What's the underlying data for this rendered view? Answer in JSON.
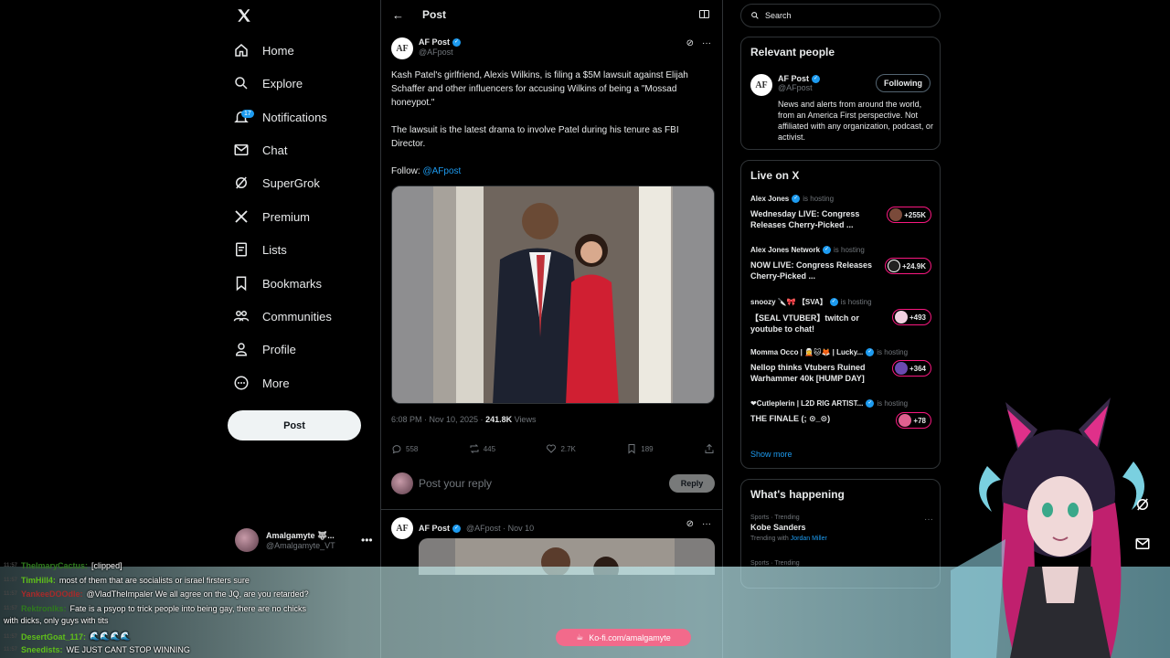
{
  "nav": {
    "items": [
      {
        "label": "Home",
        "icon": "home-icon"
      },
      {
        "label": "Explore",
        "icon": "search-icon"
      },
      {
        "label": "Notifications",
        "icon": "bell-icon",
        "badge": "17"
      },
      {
        "label": "Chat",
        "icon": "mail-icon"
      },
      {
        "label": "SuperGrok",
        "icon": "grok-icon"
      },
      {
        "label": "Premium",
        "icon": "x-icon"
      },
      {
        "label": "Lists",
        "icon": "list-icon"
      },
      {
        "label": "Bookmarks",
        "icon": "bookmark-icon"
      },
      {
        "label": "Communities",
        "icon": "people-icon"
      },
      {
        "label": "Profile",
        "icon": "person-icon"
      },
      {
        "label": "More",
        "icon": "more-circle-icon"
      }
    ],
    "post_label": "Post",
    "account": {
      "name": "Amalgamyte 🐺...",
      "handle": "@Amalgamyte_VT"
    }
  },
  "header": {
    "title": "Post"
  },
  "post": {
    "avatar_text": "AF",
    "author": "AF Post",
    "handle": "@AFpost",
    "p1": "Kash Patel's girlfriend, Alexis Wilkins, is filing a $5M lawsuit against Elijah Schaffer and other influencers for accusing Wilkins of being a \"Mossad honeypot.\"",
    "p2": "The lawsuit is the latest drama to involve Patel during his tenure as FBI Director.",
    "follow_prefix": "Follow: ",
    "follow_link": "@AFpost",
    "time": "6:08 PM · Nov 10, 2025 · ",
    "views_count": "241.8K",
    "views_label": " Views",
    "replies": "558",
    "reposts": "445",
    "likes": "2.7K",
    "bookmarks": "189",
    "reply_placeholder": "Post your reply",
    "reply_button": "Reply"
  },
  "next_post": {
    "author": "AF Post",
    "handle": "@AFpost · Nov 10"
  },
  "search": {
    "placeholder": "Search"
  },
  "relevant": {
    "title": "Relevant people",
    "name": "AF Post",
    "handle": "@AFpost",
    "follow_label": "Following",
    "bio": "News and alerts from around the world, from an America First perspective. Not affiliated with any organization, podcast, or activist."
  },
  "live": {
    "title": "Live on X",
    "hosting_label": "is hosting",
    "items": [
      {
        "host": "Alex Jones",
        "title": "Wednesday LIVE: Congress Releases Cherry-Picked ...",
        "count": "+255K"
      },
      {
        "host": "Alex Jones Network",
        "title": "NOW LIVE: Congress Releases Cherry-Picked ...",
        "count": "+24.9K"
      },
      {
        "host": "snoozy 🔪🎀 【SVA】",
        "title": "【SEAL VTUBER】twitch or youtube to chat!",
        "count": "+493"
      },
      {
        "host": "Momma Occo | 🧝🐱🦊 | Lucky...",
        "title": "Nellop thinks Vtubers Ruined Warhammer 40k [HUMP DAY]",
        "count": "+364"
      },
      {
        "host": "❤Cutleplerin | L2D RIG ARTIST...",
        "title": "THE FINALE (;  ⊙_⊙)",
        "count": "+78"
      }
    ],
    "show_more": "Show more"
  },
  "happening": {
    "title": "What's happening",
    "items": [
      {
        "category": "Sports · Trending",
        "title": "Kobe Sanders",
        "sub_prefix": "Trending with ",
        "sub_link": "Jordan Miller"
      },
      {
        "category": "Sports · Trending"
      }
    ]
  },
  "chat": [
    {
      "ts": "11:57",
      "user": "TheImaryCactus:",
      "msg": "[clipped]"
    },
    {
      "ts": "11:57",
      "user": "TimHill4:",
      "msg": "most of them that are socialists or israel firsters sure"
    },
    {
      "ts": "11:57",
      "user": "YankeeDOOdle:",
      "msg": "@VladTheImpaler We all agree on the JQ, are you retarded?"
    },
    {
      "ts": "11:57",
      "user": "Rektronlks:",
      "msg": "Fate is a psyop to trick people into being gay, there are no chicks"
    },
    {
      "ts": "",
      "user": "",
      "msg": "with dicks, only guys with tits"
    },
    {
      "ts": "11:57",
      "user": "DesertGoat_117:",
      "msg": "🌊🌊🌊🌊"
    },
    {
      "ts": "11:57",
      "user": "Sneedists:",
      "msg": "WE JUST CANT STOP WINNING"
    }
  ],
  "kofi": {
    "label": "Ko-fi.com/amalgamyte"
  },
  "colors": {
    "accent": "#1d9bf0",
    "live": "#f91880",
    "bg": "#000000"
  }
}
